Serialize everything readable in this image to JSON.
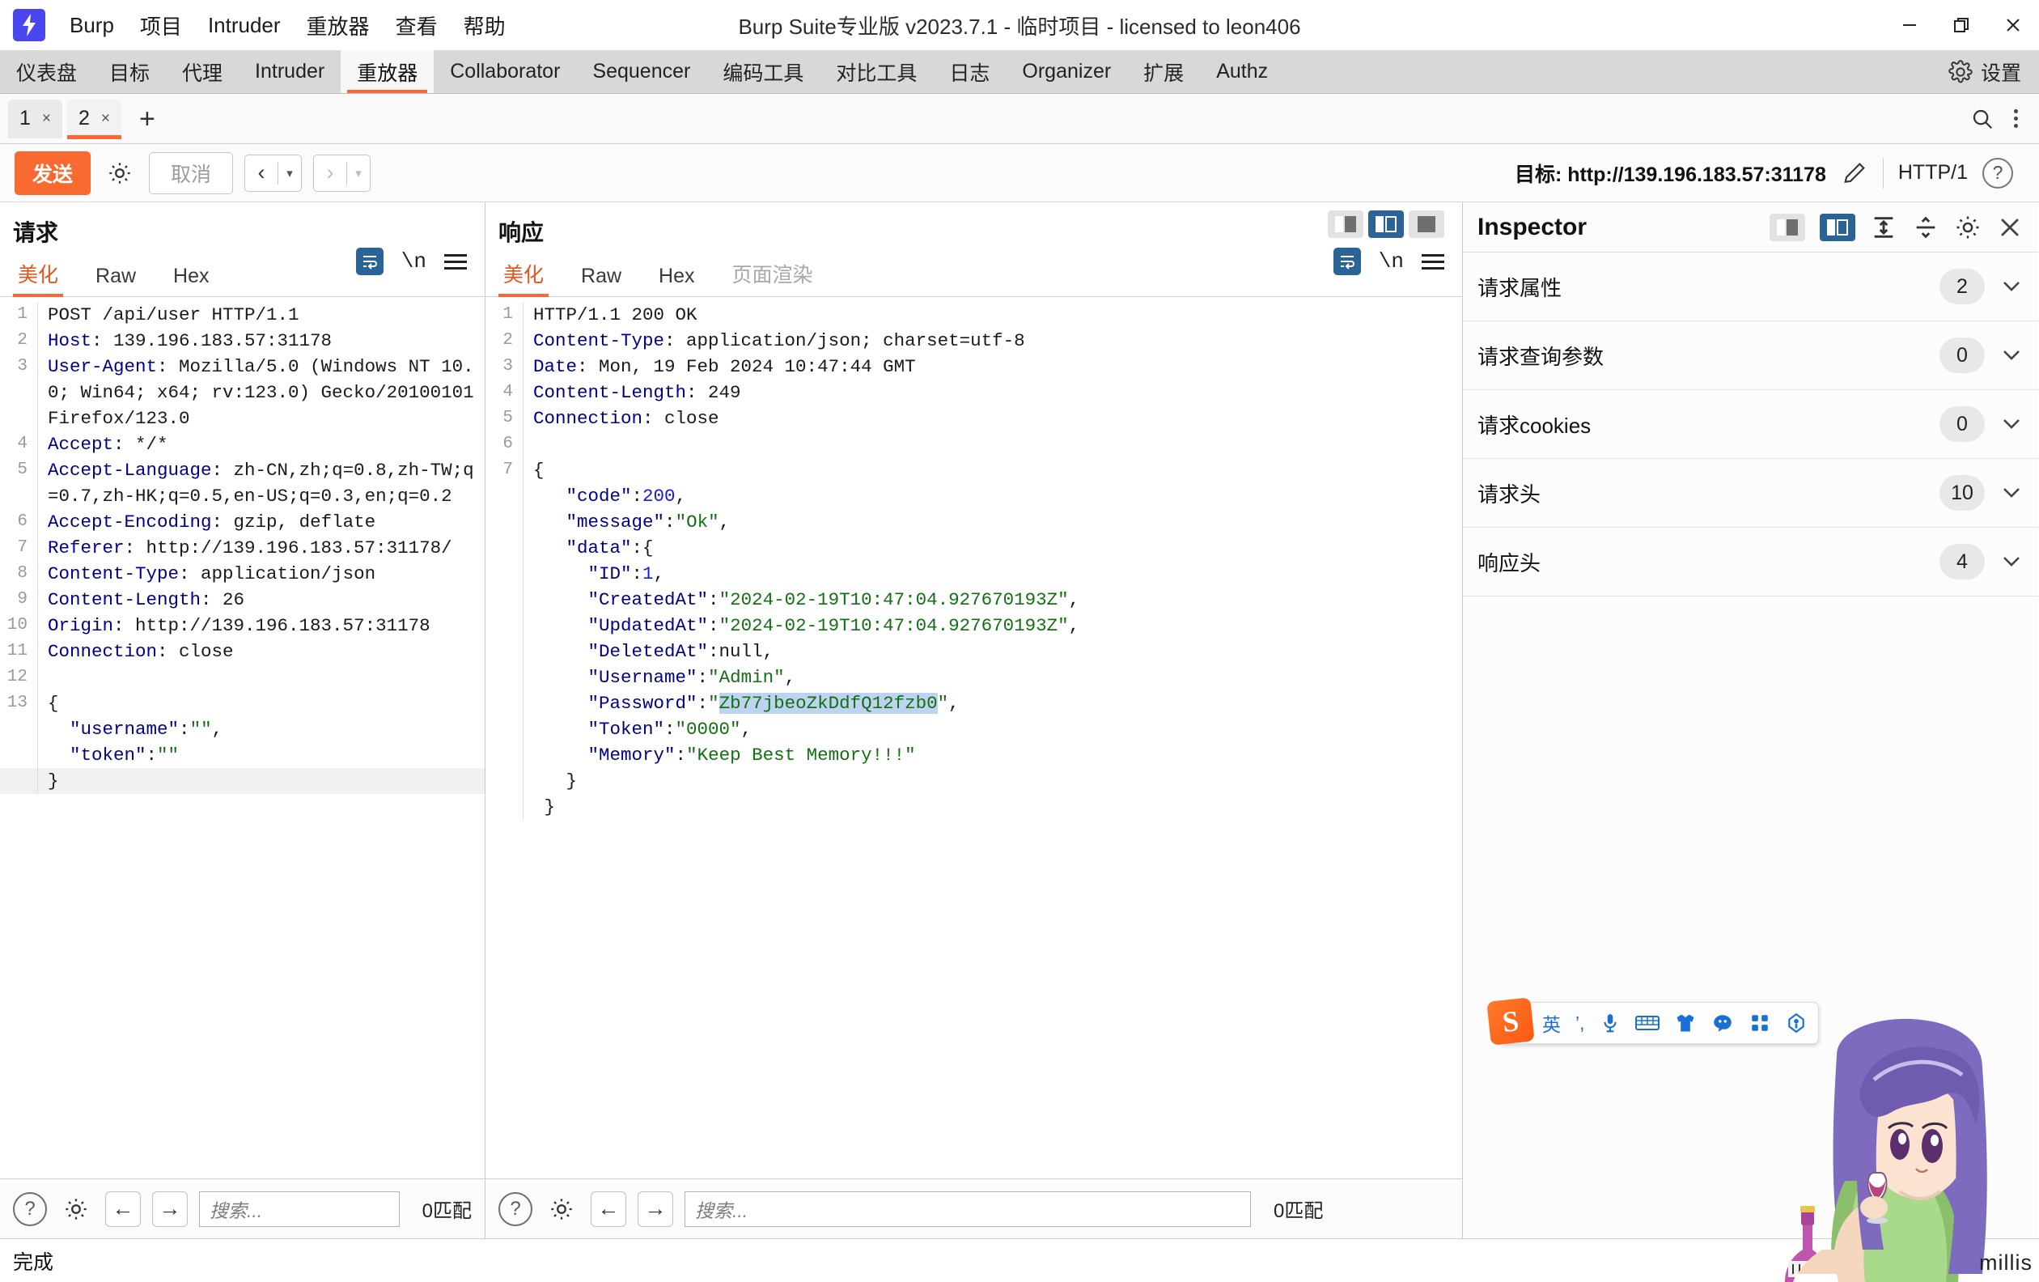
{
  "window": {
    "title": "Burp Suite专业版  v2023.7.1 - 临时项目 - licensed to leon406",
    "app_name": "Burp",
    "logo_glyph": "⚡",
    "minimize": "—",
    "maximize": "❐",
    "close": "✕"
  },
  "menubar": {
    "items": [
      {
        "label": "Burp"
      },
      {
        "label": "项目"
      },
      {
        "label": "Intruder"
      },
      {
        "label": "重放器"
      },
      {
        "label": "查看"
      },
      {
        "label": "帮助"
      }
    ]
  },
  "main_tabs": {
    "items": [
      {
        "label": "仪表盘",
        "active": false
      },
      {
        "label": "目标",
        "active": false
      },
      {
        "label": "代理",
        "active": false
      },
      {
        "label": "Intruder",
        "active": false
      },
      {
        "label": "重放器",
        "active": true
      },
      {
        "label": "Collaborator",
        "active": false
      },
      {
        "label": "Sequencer",
        "active": false
      },
      {
        "label": "编码工具",
        "active": false
      },
      {
        "label": "对比工具",
        "active": false
      },
      {
        "label": "日志",
        "active": false
      },
      {
        "label": "Organizer",
        "active": false
      },
      {
        "label": "扩展",
        "active": false
      },
      {
        "label": "Authz",
        "active": false
      }
    ],
    "settings_label": "设置"
  },
  "repeater_tabs": {
    "items": [
      {
        "label": "1",
        "close": "×",
        "active": false
      },
      {
        "label": "2",
        "close": "×",
        "active": true
      }
    ],
    "add_label": "+"
  },
  "action_bar": {
    "send_label": "发送",
    "cancel_label": "取消",
    "prev_arrow": "‹",
    "next_arrow": "›",
    "caret": "▾",
    "target_label": "目标: http://139.196.183.57:31178",
    "http_version": "HTTP/1",
    "help_glyph": "?"
  },
  "request_pane": {
    "title": "请求",
    "tabs": [
      {
        "label": "美化",
        "active": true
      },
      {
        "label": "Raw",
        "active": false
      },
      {
        "label": "Hex",
        "active": false
      }
    ],
    "newline_label": "\\n",
    "lines": [
      {
        "n": "1",
        "segments": [
          {
            "t": "POST /api/user HTTP/1.1",
            "c": "plain"
          }
        ]
      },
      {
        "n": "2",
        "segments": [
          {
            "t": "Host",
            "c": "hk"
          },
          {
            "t": ": 139.196.183.57:31178",
            "c": "plain"
          }
        ]
      },
      {
        "n": "3",
        "segments": [
          {
            "t": "User-Agent",
            "c": "hk"
          },
          {
            "t": ": Mozilla/5.0 (Windows NT 10.0; Win64; x64; rv:123.0) Gecko/20100101 Firefox/123.0",
            "c": "plain"
          }
        ]
      },
      {
        "n": "4",
        "segments": [
          {
            "t": "Accept",
            "c": "hk"
          },
          {
            "t": ": */*",
            "c": "plain"
          }
        ]
      },
      {
        "n": "5",
        "segments": [
          {
            "t": "Accept-Language",
            "c": "hk"
          },
          {
            "t": ": zh-CN,zh;q=0.8,zh-TW;q=0.7,zh-HK;q=0.5,en-US;q=0.3,en;q=0.2",
            "c": "plain"
          }
        ]
      },
      {
        "n": "6",
        "segments": [
          {
            "t": "Accept-Encoding",
            "c": "hk"
          },
          {
            "t": ": gzip, deflate",
            "c": "plain"
          }
        ]
      },
      {
        "n": "7",
        "segments": [
          {
            "t": "Referer",
            "c": "hk"
          },
          {
            "t": ": http://139.196.183.57:31178/",
            "c": "plain"
          }
        ]
      },
      {
        "n": "8",
        "segments": [
          {
            "t": "Content-Type",
            "c": "hk"
          },
          {
            "t": ": application/json",
            "c": "plain"
          }
        ]
      },
      {
        "n": "9",
        "segments": [
          {
            "t": "Content-Length",
            "c": "hk"
          },
          {
            "t": ": 26",
            "c": "plain"
          }
        ]
      },
      {
        "n": "10",
        "segments": [
          {
            "t": "Origin",
            "c": "hk"
          },
          {
            "t": ": http://139.196.183.57:31178",
            "c": "plain"
          }
        ]
      },
      {
        "n": "11",
        "segments": [
          {
            "t": "Connection",
            "c": "hk"
          },
          {
            "t": ": close",
            "c": "plain"
          }
        ]
      },
      {
        "n": "12",
        "segments": [
          {
            "t": "",
            "c": "plain"
          }
        ]
      },
      {
        "n": "13",
        "segments": [
          {
            "t": "{",
            "c": "plain"
          }
        ]
      },
      {
        "n": "",
        "segments": [
          {
            "t": "  \"username\"",
            "c": "hk"
          },
          {
            "t": ":",
            "c": "plain"
          },
          {
            "t": "\"\"",
            "c": "str"
          },
          {
            "t": ",",
            "c": "plain"
          }
        ]
      },
      {
        "n": "",
        "segments": [
          {
            "t": "  \"token\"",
            "c": "hk"
          },
          {
            "t": ":",
            "c": "plain"
          },
          {
            "t": "\"\"",
            "c": "str"
          }
        ]
      },
      {
        "n": "",
        "segments": [
          {
            "t": "}",
            "c": "plain"
          }
        ],
        "current": true
      }
    ],
    "footer": {
      "help_glyph": "?",
      "back_glyph": "←",
      "fwd_glyph": "→",
      "search_placeholder": "搜索...",
      "matches": "0匹配"
    }
  },
  "response_pane": {
    "title": "响应",
    "tabs": [
      {
        "label": "美化",
        "active": true
      },
      {
        "label": "Raw",
        "active": false
      },
      {
        "label": "Hex",
        "active": false
      },
      {
        "label": "页面渲染",
        "active": false,
        "muted": true
      }
    ],
    "newline_label": "\\n",
    "lines": [
      {
        "n": "1",
        "segments": [
          {
            "t": "HTTP/1.1 200 OK",
            "c": "plain"
          }
        ]
      },
      {
        "n": "2",
        "segments": [
          {
            "t": "Content-Type",
            "c": "hk"
          },
          {
            "t": ": application/json; charset=utf-8",
            "c": "plain"
          }
        ]
      },
      {
        "n": "3",
        "segments": [
          {
            "t": "Date",
            "c": "hk"
          },
          {
            "t": ": Mon, 19 Feb 2024 10:47:44 GMT",
            "c": "plain"
          }
        ]
      },
      {
        "n": "4",
        "segments": [
          {
            "t": "Content-Length",
            "c": "hk"
          },
          {
            "t": ": 249",
            "c": "plain"
          }
        ]
      },
      {
        "n": "5",
        "segments": [
          {
            "t": "Connection",
            "c": "hk"
          },
          {
            "t": ": close",
            "c": "plain"
          }
        ]
      },
      {
        "n": "6",
        "segments": [
          {
            "t": "",
            "c": "plain"
          }
        ]
      },
      {
        "n": "7",
        "segments": [
          {
            "t": "{",
            "c": "plain"
          }
        ]
      },
      {
        "n": "",
        "segments": [
          {
            "t": "   \"code\"",
            "c": "hk"
          },
          {
            "t": ":",
            "c": "plain"
          },
          {
            "t": "200",
            "c": "num"
          },
          {
            "t": ",",
            "c": "plain"
          }
        ]
      },
      {
        "n": "",
        "segments": [
          {
            "t": "   \"message\"",
            "c": "hk"
          },
          {
            "t": ":",
            "c": "plain"
          },
          {
            "t": "\"Ok\"",
            "c": "str"
          },
          {
            "t": ",",
            "c": "plain"
          }
        ]
      },
      {
        "n": "",
        "segments": [
          {
            "t": "   \"data\"",
            "c": "hk"
          },
          {
            "t": ":{",
            "c": "plain"
          }
        ]
      },
      {
        "n": "",
        "segments": [
          {
            "t": "     \"ID\"",
            "c": "hk"
          },
          {
            "t": ":",
            "c": "plain"
          },
          {
            "t": "1",
            "c": "num"
          },
          {
            "t": ",",
            "c": "plain"
          }
        ]
      },
      {
        "n": "",
        "segments": [
          {
            "t": "     \"CreatedAt\"",
            "c": "hk"
          },
          {
            "t": ":",
            "c": "plain"
          },
          {
            "t": "\"2024-02-19T10:47:04.927670193Z\"",
            "c": "str"
          },
          {
            "t": ",",
            "c": "plain"
          }
        ]
      },
      {
        "n": "",
        "segments": [
          {
            "t": "     \"UpdatedAt\"",
            "c": "hk"
          },
          {
            "t": ":",
            "c": "plain"
          },
          {
            "t": "\"2024-02-19T10:47:04.927670193Z\"",
            "c": "str"
          },
          {
            "t": ",",
            "c": "plain"
          }
        ]
      },
      {
        "n": "",
        "segments": [
          {
            "t": "     \"DeletedAt\"",
            "c": "hk"
          },
          {
            "t": ":null,",
            "c": "plain"
          }
        ]
      },
      {
        "n": "",
        "segments": [
          {
            "t": "     \"Username\"",
            "c": "hk"
          },
          {
            "t": ":",
            "c": "plain"
          },
          {
            "t": "\"Admin\"",
            "c": "str"
          },
          {
            "t": ",",
            "c": "plain"
          }
        ]
      },
      {
        "n": "",
        "segments": [
          {
            "t": "     \"Password\"",
            "c": "hk"
          },
          {
            "t": ":",
            "c": "plain"
          },
          {
            "t": "\"",
            "c": "str"
          },
          {
            "t": "Zb77jbeoZkDdfQ12fzb0",
            "c": "str sel"
          },
          {
            "t": "\"",
            "c": "str"
          },
          {
            "t": ",",
            "c": "plain"
          }
        ]
      },
      {
        "n": "",
        "segments": [
          {
            "t": "     \"Token\"",
            "c": "hk"
          },
          {
            "t": ":",
            "c": "plain"
          },
          {
            "t": "\"0000\"",
            "c": "str"
          },
          {
            "t": ",",
            "c": "plain"
          }
        ]
      },
      {
        "n": "",
        "segments": [
          {
            "t": "     \"Memory\"",
            "c": "hk"
          },
          {
            "t": ":",
            "c": "plain"
          },
          {
            "t": "\"Keep Best Memory!!!\"",
            "c": "str"
          }
        ]
      },
      {
        "n": "",
        "segments": [
          {
            "t": "   }",
            "c": "plain"
          }
        ]
      },
      {
        "n": "",
        "segments": [
          {
            "t": " }",
            "c": "plain"
          }
        ]
      }
    ],
    "footer": {
      "help_glyph": "?",
      "back_glyph": "←",
      "fwd_glyph": "→",
      "search_placeholder": "搜索...",
      "matches": "0匹配"
    }
  },
  "inspector": {
    "title": "Inspector",
    "close_glyph": "✕",
    "rows": [
      {
        "label": "请求属性",
        "count": "2"
      },
      {
        "label": "请求查询参数",
        "count": "0"
      },
      {
        "label": "请求cookies",
        "count": "0"
      },
      {
        "label": "请求头",
        "count": "10"
      },
      {
        "label": "响应头",
        "count": "4"
      }
    ],
    "chevron": "ˇ"
  },
  "status_bar": {
    "text": "完成"
  },
  "ime": {
    "logo": "S",
    "mode": "英",
    "punct": "’,",
    "items": [
      "mic-icon",
      "keyboard-icon",
      "skin-icon",
      "emoji-icon",
      "apps-icon",
      "tools-icon"
    ]
  },
  "watermark": {
    "text": "millis"
  },
  "colors": {
    "accent": "#ff6633",
    "send_button": "#f96a31",
    "active_toggle": "#2a6496",
    "header_key": "#00008a",
    "string": "#127012",
    "number": "#1a1ad6",
    "selection": "#bdd3ef",
    "logo": "#4a46ef"
  }
}
